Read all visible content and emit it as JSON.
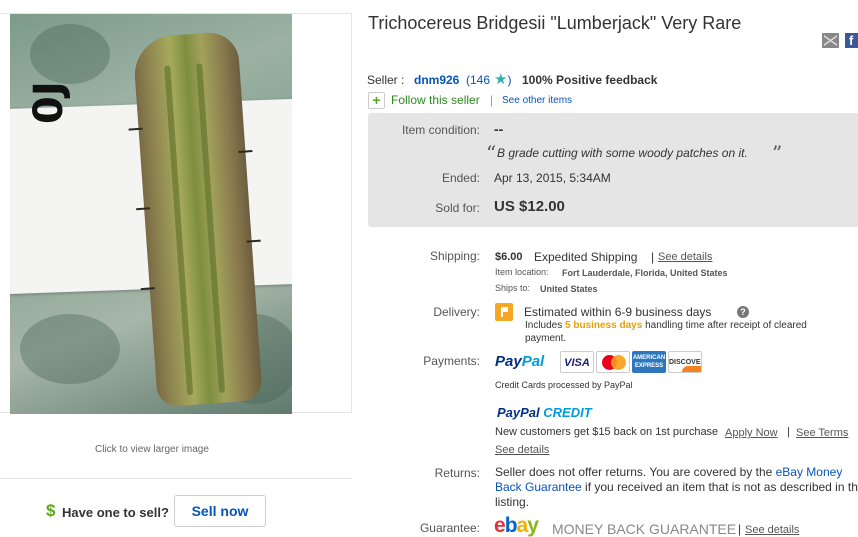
{
  "image_panel": {
    "paper_label": "0J",
    "caption": "Click to view larger image"
  },
  "sell": {
    "dollar": "$",
    "prompt": "Have one to sell?",
    "button": "Sell now"
  },
  "listing": {
    "title": "Trichocereus Bridgesii \"Lumberjack\" Very Rare"
  },
  "share": {
    "facebook": "f"
  },
  "seller": {
    "label": "Seller :",
    "name": "dnm926",
    "feedback_count": "(146",
    "star": "★",
    "feedback_close": ")",
    "positive_pct": "100%",
    "positive_label": "Positive feedback",
    "follow_icon": "+",
    "follow": "Follow this seller",
    "separator": "|",
    "other_items": "See other items"
  },
  "status": {
    "condition_label": "Item condition:",
    "condition_value": "--",
    "quote_open": "“",
    "condition_note": "B grade cutting with some woody patches on it.",
    "quote_close": "”",
    "ended_label": "Ended:",
    "ended_value": "Apr 13, 2015, 5:34AM",
    "sold_label": "Sold for:",
    "sold_value": "US $12.00"
  },
  "shipping": {
    "label": "Shipping:",
    "price": "$6.00",
    "method": "Expedited Shipping",
    "separator": "|",
    "details": "See details",
    "location_label": "Item location:",
    "location_value": "Fort Lauderdale, Florida, United States",
    "ships_to_label": "Ships to:",
    "ships_to_value": "United States"
  },
  "delivery": {
    "label": "Delivery:",
    "estimate": "Estimated within 6-9 business days",
    "help": "?",
    "includes_prefix": "Includes",
    "includes_highlight": "5 business days",
    "includes_suffix": "handling time after receipt of cleared",
    "includes_line2": "payment."
  },
  "payments": {
    "label": "Payments:",
    "paypal_a": "Pay",
    "paypal_b": "Pal",
    "cards": [
      "VISA",
      "",
      "AMERICAN EXPRESS",
      "DISCOVER"
    ],
    "cc_text": "Credit Cards processed by PayPal",
    "credit_a": "PayPal",
    "credit_b": "CREDIT",
    "new_customers": "New customers get $15 back on 1st purchase",
    "apply": "Apply Now",
    "separator": "|",
    "terms": "See Terms",
    "details": "See details"
  },
  "returns": {
    "label": "Returns:",
    "text_before": "Seller does not offer returns. You are covered by the ",
    "link": "eBay Money Back Guarantee",
    "text_after": " if you received an item that is not as described in the listing."
  },
  "guarantee": {
    "label": "Guarantee:",
    "logo": [
      "e",
      "b",
      "a",
      "y"
    ],
    "mbg": "MONEY BACK GUARANTEE",
    "separator": "|",
    "details": "See details"
  },
  "colors": {
    "link_blue": "#0654ba",
    "status_bg": "#e5e5e5",
    "follow_green": "#2b8a1f",
    "highlight_orange": "#e7a200"
  }
}
